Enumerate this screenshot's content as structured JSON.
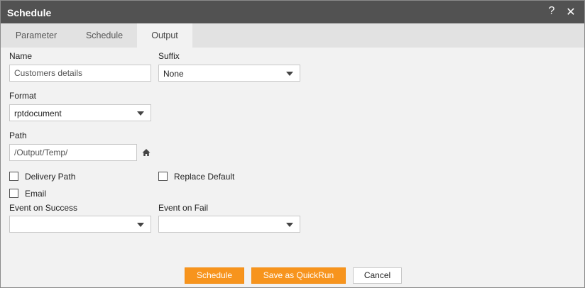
{
  "titlebar": {
    "title": "Schedule",
    "help": "?",
    "close": "✕"
  },
  "tabs": [
    {
      "label": "Parameter",
      "active": false
    },
    {
      "label": "Schedule",
      "active": false
    },
    {
      "label": "Output",
      "active": true
    }
  ],
  "form": {
    "name_label": "Name",
    "name_value": "Customers details",
    "suffix_label": "Suffix",
    "suffix_value": "None",
    "format_label": "Format",
    "format_value": "rptdocument",
    "path_label": "Path",
    "path_value": "/Output/Temp/",
    "delivery_path_label": "Delivery Path",
    "replace_default_label": "Replace Default",
    "email_label": "Email",
    "event_success_label": "Event on Success",
    "event_success_value": "",
    "event_fail_label": "Event on Fail",
    "event_fail_value": ""
  },
  "buttons": {
    "schedule": "Schedule",
    "save_quickrun": "Save as QuickRun",
    "cancel": "Cancel"
  },
  "colors": {
    "titlebar": "#525252",
    "accent": "#f7941d",
    "tabbar": "#e2e2e2",
    "body": "#f2f2f2"
  }
}
